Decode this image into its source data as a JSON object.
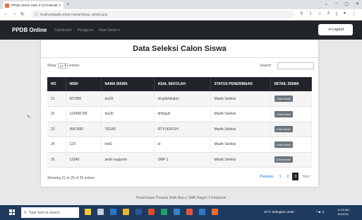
{
  "browser": {
    "tab_title": "PPDB Online SMK 3 KOTABUMI",
    "url": "localhost/ppdb-online-master/siswa_seleksi.php"
  },
  "navbar": {
    "brand": "PPDB Online",
    "menu": [
      "Dashboard",
      "Pengguna",
      "Data Siswa ▾"
    ],
    "logout": "Logout"
  },
  "card": {
    "title": "Data Seleksi Calon Siswa",
    "show_label": "Show",
    "show_value": "10",
    "entries_label": "entries",
    "search_label": "Search:"
  },
  "table": {
    "headers": [
      "NO",
      "NISN",
      "NAMA SISWA",
      "ASAL SEKOLAH",
      "STATUS PENERIMAAN",
      "DETAIL SISWA"
    ],
    "rows": [
      {
        "no": "21",
        "nisn": "567890",
        "nama": "tes25",
        "asal": "sfcgvbhknjkm",
        "status": "Masih Seleksi",
        "detail": "Lihat Detail"
      },
      {
        "no": "22",
        "nisn": "123456789",
        "nama": "tes30",
        "asal": "drtfyguh",
        "status": "Masih Seleksi",
        "detail": "Lihat Detail"
      },
      {
        "no": "23",
        "nisn": "4567890",
        "nama": "TES40",
        "asal": "RTYUIOFGH",
        "status": "Masih Seleksi",
        "detail": "Lihat Detail"
      },
      {
        "no": "24",
        "nisn": "123",
        "nama": "test1",
        "asal": "te",
        "status": "Masih Seleksi",
        "detail": "Lihat Detail"
      },
      {
        "no": "25",
        "nisn": "12345",
        "nama": "andri sugianto",
        "asal": "SMP 1",
        "status": "Masih Seleksi",
        "detail": "Lihat Detail"
      }
    ]
  },
  "footer_info": "Showing 21 to 25 of 25 entries",
  "pagination": {
    "previous": "Previous",
    "pages": [
      "1",
      "2",
      "3"
    ],
    "active": "3",
    "next": "Next"
  },
  "page_footer": "Penerimaan Peserta Didik Baru | SMK Negeri 3 Kotabumi",
  "taskbar": {
    "search_placeholder": "Type here to search",
    "weather": "32°C  Sebagian cerah",
    "time": "11:25 AM",
    "date": "8/4/2022"
  }
}
